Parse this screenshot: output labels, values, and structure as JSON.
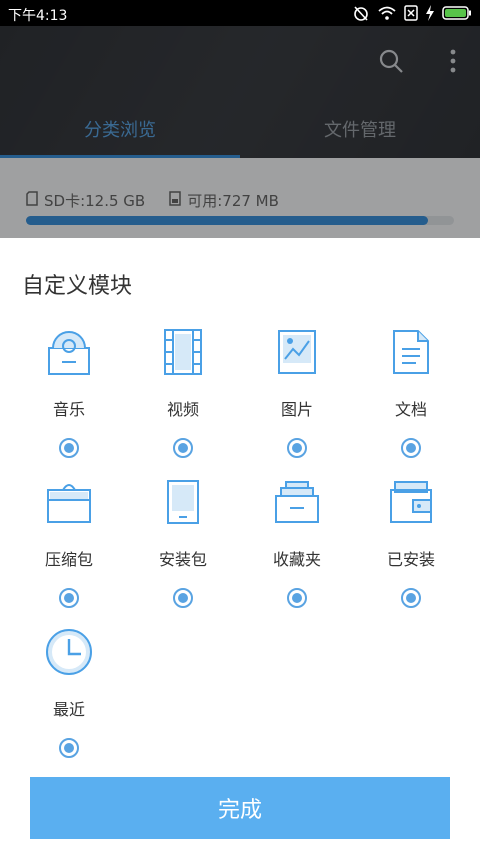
{
  "status_bar": {
    "time": "下午4:13"
  },
  "app_bar": {
    "tabs": [
      {
        "label": "分类浏览",
        "active": true
      },
      {
        "label": "文件管理",
        "active": false
      }
    ],
    "accent_color": "#3a8fd9"
  },
  "storage": {
    "sd_label": "SD卡:12.5 GB",
    "available_label": "可用:727 MB",
    "used_fraction": 0.94
  },
  "sheet": {
    "title": "自定义模块",
    "modules": [
      {
        "label": "音乐",
        "icon": "music-icon",
        "selected": true
      },
      {
        "label": "视频",
        "icon": "video-icon",
        "selected": true
      },
      {
        "label": "图片",
        "icon": "image-icon",
        "selected": true
      },
      {
        "label": "文档",
        "icon": "document-icon",
        "selected": true
      },
      {
        "label": "压缩包",
        "icon": "archive-icon",
        "selected": true
      },
      {
        "label": "安装包",
        "icon": "apk-icon",
        "selected": true
      },
      {
        "label": "收藏夹",
        "icon": "favorites-icon",
        "selected": true
      },
      {
        "label": "已安装",
        "icon": "installed-icon",
        "selected": true
      },
      {
        "label": "最近",
        "icon": "recent-icon",
        "selected": true
      }
    ],
    "done_label": "完成"
  }
}
